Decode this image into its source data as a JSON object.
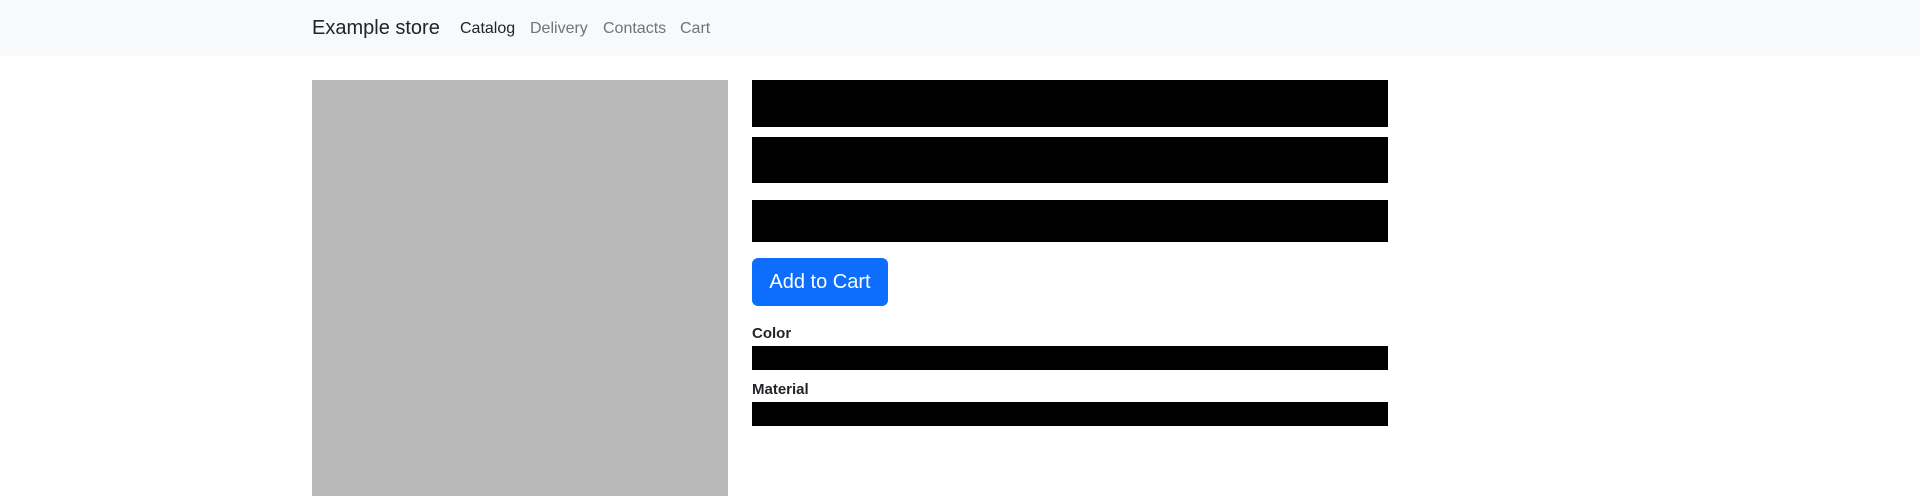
{
  "navbar": {
    "brand": "Example store",
    "links": [
      {
        "label": "Catalog",
        "active": true
      },
      {
        "label": "Delivery",
        "active": false
      },
      {
        "label": "Contacts",
        "active": false
      },
      {
        "label": "Cart",
        "active": false
      }
    ]
  },
  "product": {
    "add_to_cart_label": "Add to Cart",
    "attributes": [
      {
        "label": "Color"
      },
      {
        "label": "Material"
      }
    ]
  },
  "colors": {
    "navbar_bg": "#f8f9fa",
    "primary_button": "#0d6efd",
    "image_placeholder": "#b9b9b9",
    "redaction": "#000000"
  }
}
